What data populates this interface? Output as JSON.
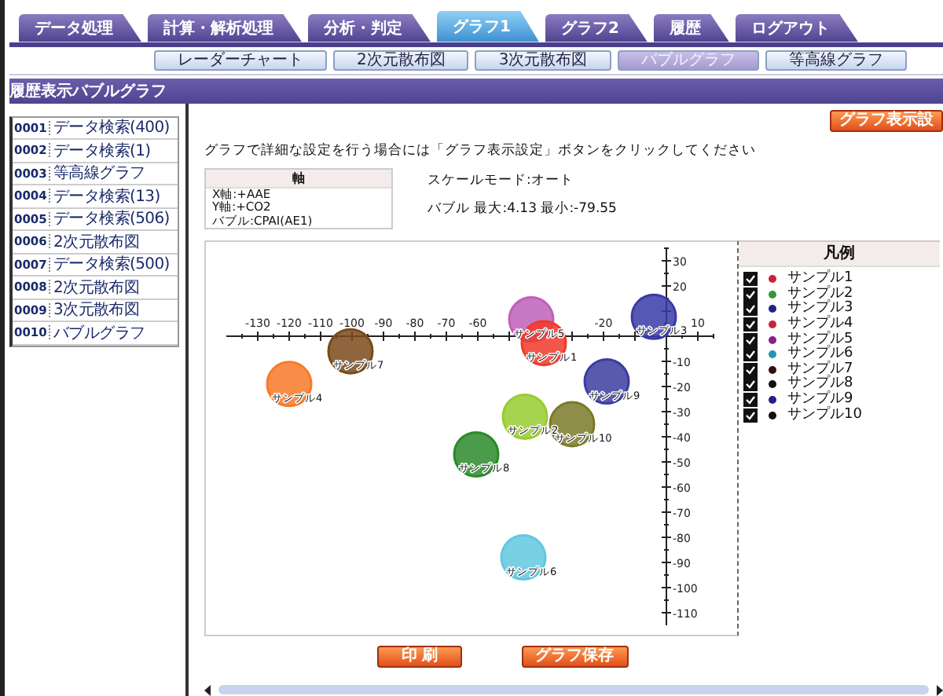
{
  "tabs": [
    {
      "label": "データ処理",
      "selected": false
    },
    {
      "label": "計算・解析処理",
      "selected": false
    },
    {
      "label": "分析・判定",
      "selected": false
    },
    {
      "label": "グラフ1",
      "selected": true
    },
    {
      "label": "グラフ2",
      "selected": false
    },
    {
      "label": "履歴",
      "selected": false
    },
    {
      "label": "ログアウト",
      "selected": false
    }
  ],
  "subtabs": [
    {
      "label": "レーダーチャート",
      "selected": false
    },
    {
      "label": "2次元散布図",
      "selected": false
    },
    {
      "label": "3次元散布図",
      "selected": false
    },
    {
      "label": "バブルグラフ",
      "selected": true
    },
    {
      "label": "等高線グラフ",
      "selected": false
    }
  ],
  "header": {
    "section": "履歴表示",
    "title": "バブルグラフ"
  },
  "history": [
    {
      "number": "0001",
      "label": "データ検索(400)"
    },
    {
      "number": "0002",
      "label": "データ検索(1)"
    },
    {
      "number": "0003",
      "label": "等高線グラフ"
    },
    {
      "number": "0004",
      "label": "データ検索(13)"
    },
    {
      "number": "0005",
      "label": "データ検索(506)"
    },
    {
      "number": "0006",
      "label": "2次元散布図"
    },
    {
      "number": "0007",
      "label": "データ検索(500)"
    },
    {
      "number": "0008",
      "label": "2次元散布図"
    },
    {
      "number": "0009",
      "label": "3次元散布図"
    },
    {
      "number": "0010",
      "label": "バブルグラフ"
    }
  ],
  "instruction": "グラフで詳細な設定を行う場合には「グラフ表示設定」ボタンをクリックしてください",
  "settings_button": "グラフ表示設",
  "axis_box": {
    "title": "軸",
    "lines": [
      "X軸:+AAE",
      "Y軸:+CO2",
      "バブル:CPAI(AE1)"
    ]
  },
  "scale_mode": "スケールモード:オート",
  "bubble_range": "バブル 最大:4.13 最小:-79.55",
  "chart": {
    "chart_data": {
      "type": "scatter",
      "xlim": [
        -140,
        15
      ],
      "ylim": [
        -115,
        35
      ],
      "xticks": [
        -130,
        -120,
        -110,
        -100,
        -90,
        -80,
        -70,
        -60,
        -20,
        10
      ],
      "yticks": [
        30,
        20,
        -10,
        -20,
        -30,
        -40,
        -50,
        -60,
        -70,
        -80,
        -90,
        -100,
        -110
      ],
      "series": [
        {
          "name": "サンプル5",
          "color": "#c060b8",
          "x": [
            -43
          ],
          "values": [
            6.7
          ]
        },
        {
          "name": "サンプル1",
          "color": "#f03a2a",
          "x": [
            -39
          ],
          "values": [
            -2.7
          ]
        },
        {
          "name": "サンプル3",
          "color": "#3a3aa8",
          "x": [
            -4
          ],
          "values": [
            7.7
          ]
        },
        {
          "name": "サンプル9",
          "color": "#3c3ca0",
          "x": [
            -19
          ],
          "values": [
            -18
          ]
        },
        {
          "name": "サンプル4",
          "color": "#f87a28",
          "x": [
            -120
          ],
          "values": [
            -19
          ]
        },
        {
          "name": "サンプル7",
          "color": "#7a4a1a",
          "x": [
            -100.5
          ],
          "values": [
            -6
          ]
        },
        {
          "name": "サンプル2",
          "color": "#98cc30",
          "x": [
            -45
          ],
          "values": [
            -32
          ]
        },
        {
          "name": "サンプル10",
          "color": "#7a7a28",
          "x": [
            -30
          ],
          "values": [
            -35
          ]
        },
        {
          "name": "サンプル8",
          "color": "#2a8a2a",
          "x": [
            -60.5
          ],
          "values": [
            -47
          ]
        },
        {
          "name": "サンプル6",
          "color": "#60c8e0",
          "x": [
            -45.5
          ],
          "values": [
            -88
          ]
        }
      ]
    }
  },
  "legend": {
    "title": "凡例",
    "items": [
      {
        "label": "サンプル1",
        "checked": true,
        "color": "#cc2233"
      },
      {
        "label": "サンプル2",
        "checked": true,
        "color": "#339933"
      },
      {
        "label": "サンプル3",
        "checked": true,
        "color": "#222288"
      },
      {
        "label": "サンプル4",
        "checked": true,
        "color": "#cc2233"
      },
      {
        "label": "サンプル5",
        "checked": true,
        "color": "#882288"
      },
      {
        "label": "サンプル6",
        "checked": true,
        "color": "#2299aa"
      },
      {
        "label": "サンプル7",
        "checked": true,
        "color": "#331111"
      },
      {
        "label": "サンプル8",
        "checked": true,
        "color": "#111111"
      },
      {
        "label": "サンプル9",
        "checked": true,
        "color": "#222288"
      },
      {
        "label": "サンプル10",
        "checked": true,
        "color": "#111111"
      }
    ]
  },
  "buttons": [
    "印 刷",
    "グラフ保存"
  ]
}
